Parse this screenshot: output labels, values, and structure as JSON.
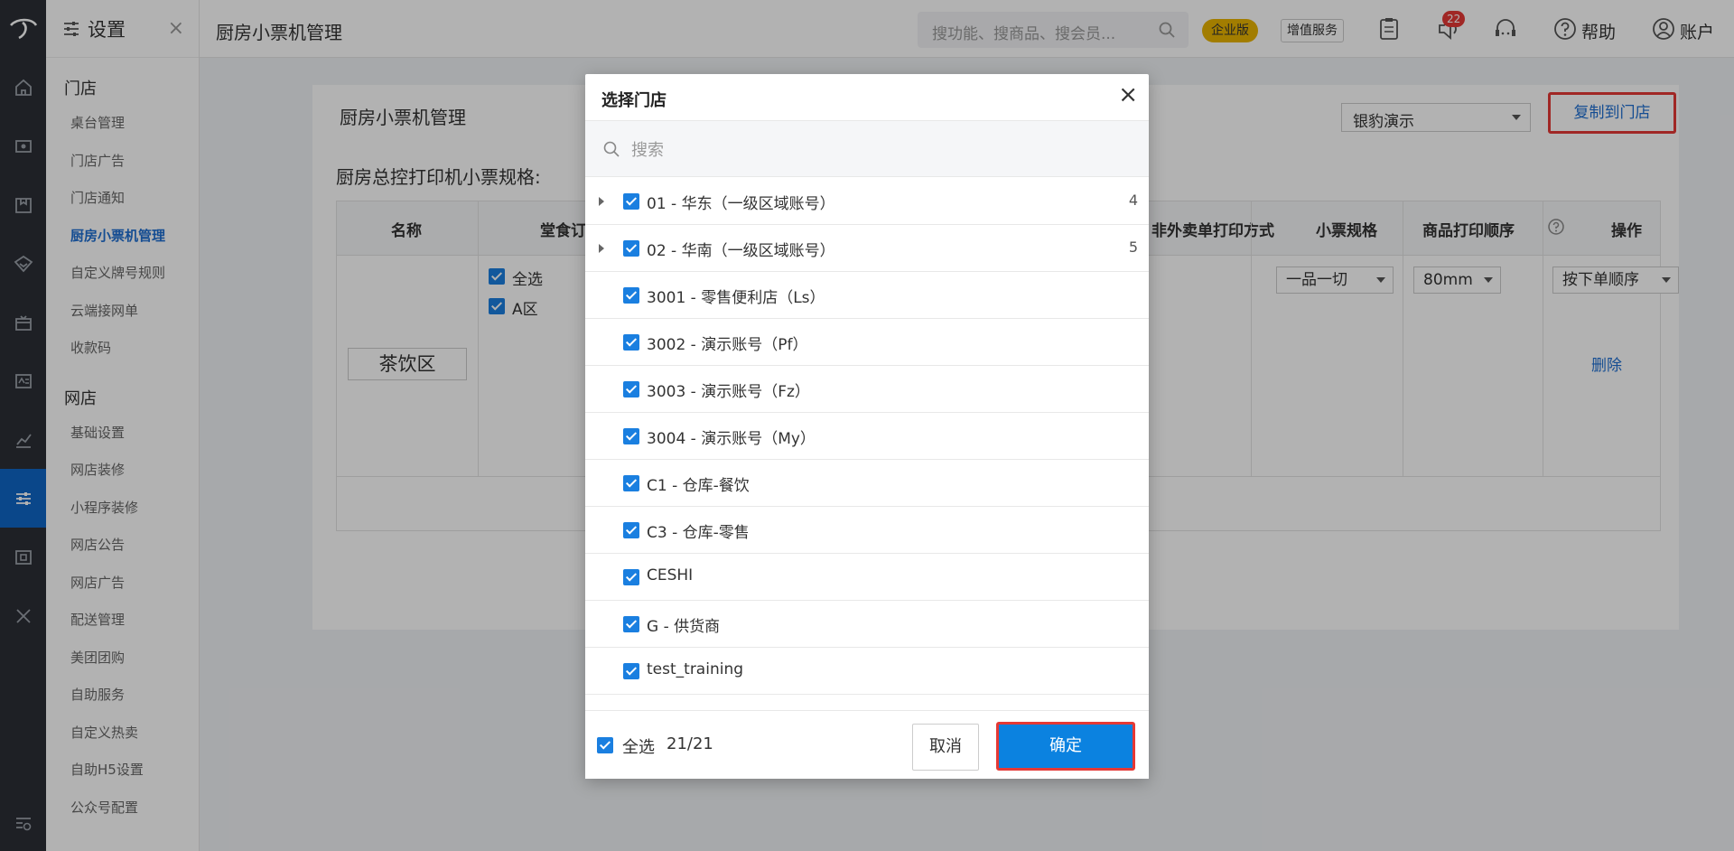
{
  "sidebar": {
    "title": "设置",
    "groups": [
      {
        "label": "门店",
        "items": [
          "桌台管理",
          "门店广告",
          "门店通知",
          "厨房小票机管理",
          "自定义牌号规则",
          "云端接网单",
          "收款码"
        ]
      },
      {
        "label": "网店",
        "items": [
          "基础设置",
          "网店装修",
          "小程序装修",
          "网店公告",
          "网店广告",
          "配送管理",
          "美团团购",
          "自助服务",
          "自定义热卖",
          "自助H5设置",
          "公众号配置"
        ]
      }
    ],
    "active_item": "厨房小票机管理"
  },
  "header": {
    "page_title": "厨房小票机管理",
    "search_placeholder": "搜功能、搜商品、搜会员...",
    "badge_enterprise": "企业版",
    "badge_vas": "增值服务",
    "notification_count": "22",
    "help_label": "帮助",
    "account_label": "账户"
  },
  "content": {
    "card_title": "厨房小票机管理",
    "store_select": "银豹演示",
    "copy_button": "复制到门店",
    "spec_label": "厨房总控打印机小票规格:",
    "columns": [
      "名称",
      "堂食订",
      "非外卖单打印方式",
      "小票规格",
      "商品打印顺序",
      "操作"
    ],
    "row": {
      "name": "茶饮区",
      "select_all": "全选",
      "area": "A区",
      "print_mode": "一品一切",
      "ticket_size": "80mm",
      "print_order": "按下单顺序",
      "delete": "删除"
    }
  },
  "modal": {
    "title": "选择门店",
    "search_placeholder": "搜索",
    "items": [
      {
        "label": "01 - 华东（一级区域账号）",
        "count": "4",
        "expandable": true
      },
      {
        "label": "02 - 华南（一级区域账号）",
        "count": "5",
        "expandable": true
      },
      {
        "label": "3001 - 零售便利店（Ls）",
        "count": "",
        "expandable": false
      },
      {
        "label": "3002 - 演示账号（Pf）",
        "count": "",
        "expandable": false
      },
      {
        "label": "3003 - 演示账号（Fz）",
        "count": "",
        "expandable": false
      },
      {
        "label": "3004 - 演示账号（My）",
        "count": "",
        "expandable": false
      },
      {
        "label": "C1 - 仓库-餐饮",
        "count": "",
        "expandable": false
      },
      {
        "label": "C3 - 仓库-零售",
        "count": "",
        "expandable": false
      },
      {
        "label": "CESHI",
        "count": "",
        "expandable": false
      },
      {
        "label": "G - 供货商",
        "count": "",
        "expandable": false
      },
      {
        "label": "test_training",
        "count": "",
        "expandable": false
      }
    ],
    "select_all": "全选",
    "selected_count": "21/21",
    "cancel": "取消",
    "confirm": "确定"
  },
  "colors": {
    "accent": "#1a7fe0",
    "highlight": "#e53935",
    "rail": "#2b2f36",
    "rail_active": "#0f66c6"
  }
}
